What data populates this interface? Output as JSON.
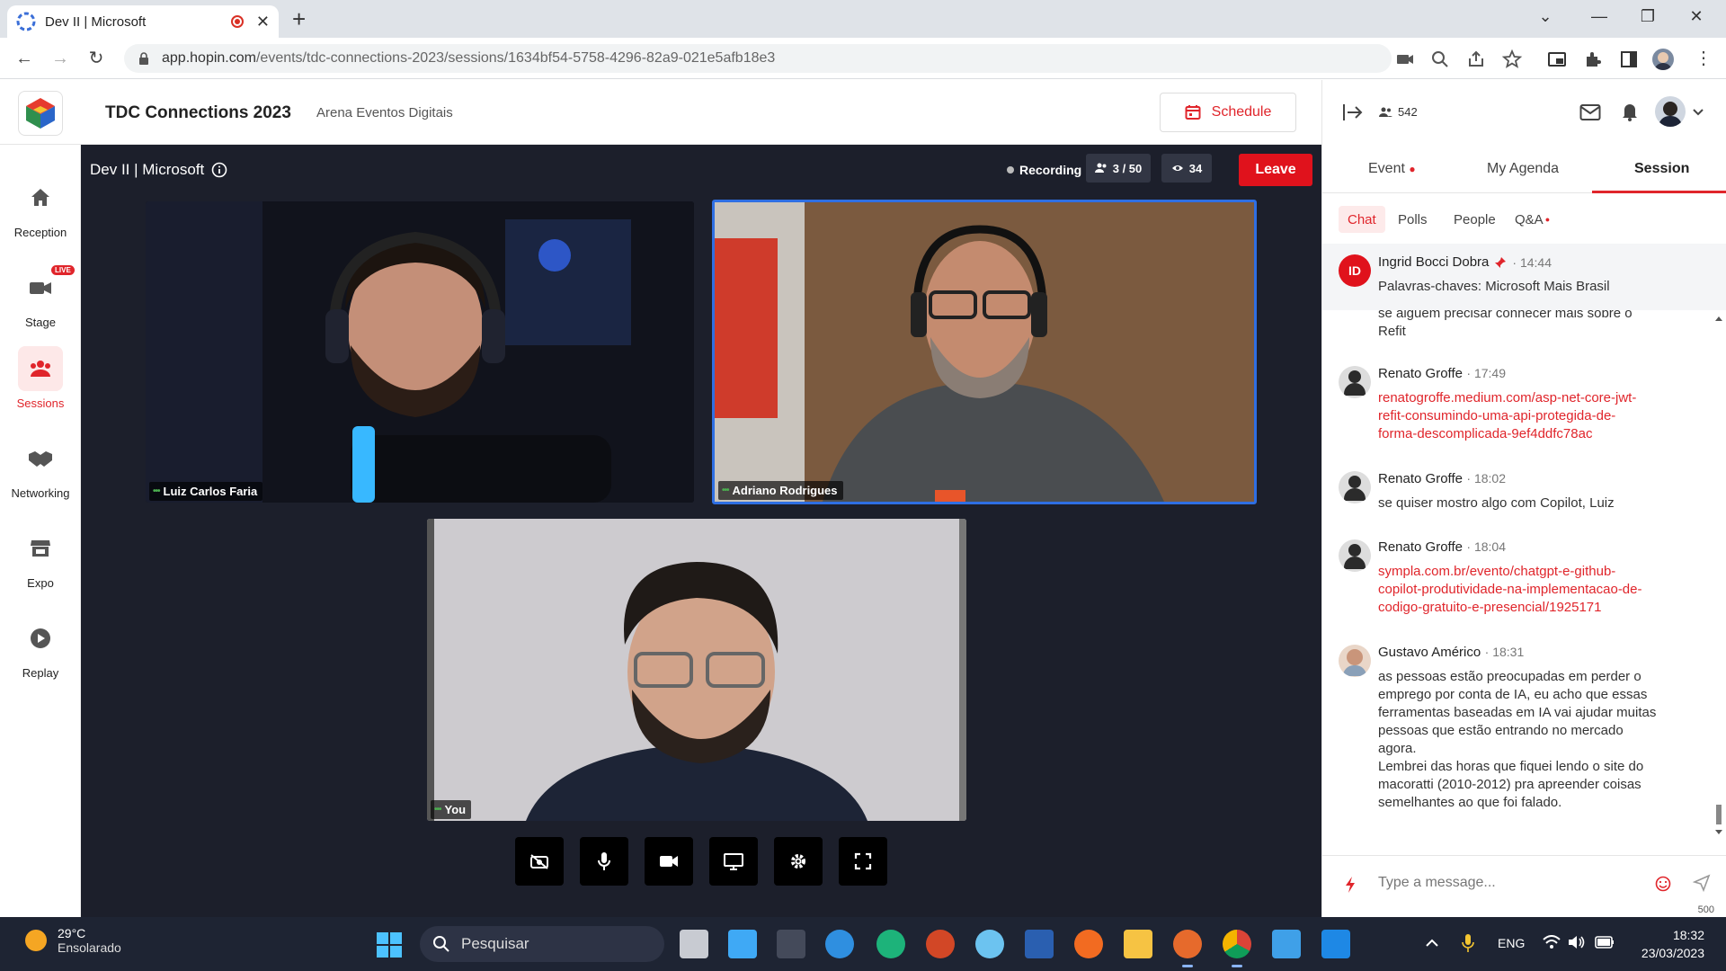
{
  "browser": {
    "tab_title": "Dev II | Microsoft",
    "url_host": "app.hopin.com",
    "url_path": "/events/tdc-connections-2023/sessions/1634bf54-5758-4296-82a9-021e5afb18e3"
  },
  "header": {
    "event_title": "TDC Connections 2023",
    "organizer": "Arena Eventos Digitais",
    "schedule_label": "Schedule"
  },
  "nav": {
    "items": [
      {
        "label": "Reception",
        "icon": "home-icon"
      },
      {
        "label": "Stage",
        "icon": "video-camera-icon",
        "badge": "LIVE"
      },
      {
        "label": "Sessions",
        "icon": "people-group-icon",
        "active": true
      },
      {
        "label": "Networking",
        "icon": "handshake-icon"
      },
      {
        "label": "Expo",
        "icon": "store-icon"
      },
      {
        "label": "Replay",
        "icon": "play-circle-icon"
      }
    ]
  },
  "stage": {
    "session_title": "Dev II | Microsoft",
    "recording_label": "Recording",
    "participants": "3 / 50",
    "viewers": "34",
    "leave_label": "Leave",
    "tiles": [
      {
        "name": "Luiz Carlos Faria"
      },
      {
        "name": "Adriano Rodrigues",
        "active_speaker": true
      },
      {
        "name": "You"
      }
    ],
    "controls": [
      "camera-off-icon",
      "microphone-icon",
      "video-icon",
      "screen-share-icon",
      "settings-gear-icon",
      "fullscreen-icon"
    ]
  },
  "panel": {
    "attendee_count": "542",
    "tabs": [
      {
        "label": "Event",
        "dot": true
      },
      {
        "label": "My Agenda"
      },
      {
        "label": "Session",
        "active": true
      }
    ],
    "subtabs": [
      {
        "label": "Chat",
        "active": true
      },
      {
        "label": "Polls"
      },
      {
        "label": "People"
      },
      {
        "label": "Q&A",
        "dot": true
      }
    ],
    "pinned": {
      "initials": "ID",
      "name": "Ingrid Bocci Dobra",
      "time": "· 14:44",
      "text": "Palavras-chaves: Microsoft Mais Brasil"
    },
    "messages": [
      {
        "partial": true,
        "lines": [
          "se alguem precisar conhecer mais sobre o",
          "Refit"
        ]
      },
      {
        "name": "Renato Groffe",
        "time": "· 17:49",
        "link": true,
        "lines": [
          "renatogroffe.medium.com/asp-net-core-jwt-",
          "refit-consumindo-uma-api-protegida-de-",
          "forma-descomplicada-9ef4ddfc78ac"
        ]
      },
      {
        "name": "Renato Groffe",
        "time": "· 18:02",
        "lines": [
          "se quiser mostro algo com Copilot, Luiz"
        ]
      },
      {
        "name": "Renato Groffe",
        "time": "· 18:04",
        "link": true,
        "lines": [
          "sympla.com.br/evento/chatgpt-e-github-",
          "copilot-produtividade-na-implementacao-de-",
          "codigo-gratuito-e-presencial/1925171"
        ]
      },
      {
        "name": "Gustavo Américo",
        "time": "· 18:31",
        "lines": [
          "as pessoas estão preocupadas em perder o",
          "emprego por conta de IA, eu acho que essas",
          "ferramentas baseadas em IA vai ajudar muitas",
          "pessoas que estão entrando no mercado",
          "agora.",
          "Lembrei das horas que fiquei lendo o site do",
          "macoratti (2010-2012) pra apreender coisas",
          "semelhantes ao que foi falado."
        ]
      }
    ],
    "composer_placeholder": "Type a message...",
    "char_limit": "500"
  },
  "taskbar": {
    "temperature": "29°C",
    "weather": "Ensolarado",
    "search_placeholder": "Pesquisar",
    "language": "ENG",
    "time": "18:32",
    "date": "23/03/2023"
  }
}
